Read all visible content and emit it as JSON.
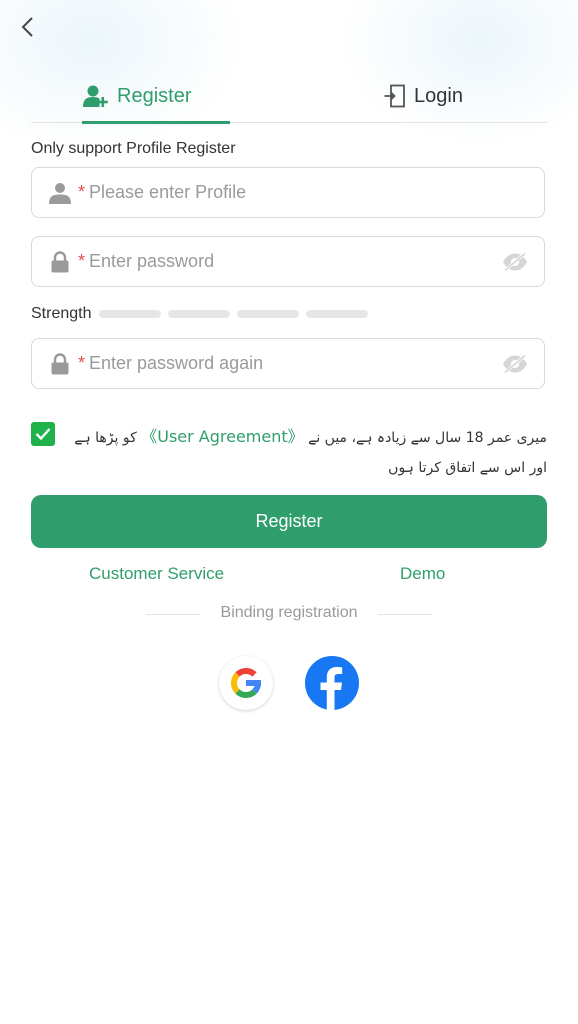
{
  "tabs": {
    "register_label": "Register",
    "login_label": "Login"
  },
  "form": {
    "hint": "Only support Profile Register",
    "profile": {
      "required_mark": "*",
      "placeholder": "Please enter Profile"
    },
    "password": {
      "required_mark": "*",
      "placeholder": "Enter password"
    },
    "strength_label": "Strength",
    "password_again": {
      "required_mark": "*",
      "placeholder": "Enter password again"
    }
  },
  "agreement": {
    "checked": true,
    "text_before": "میری عمر 18 سال سے زیادہ ہے، میں نے",
    "link": "《User Agreement》",
    "text_after": "کو پڑھا ہے اور اس سے اتفاق کرتا ہوں"
  },
  "actions": {
    "register_button": "Register",
    "customer_service": "Customer Service",
    "demo": "Demo"
  },
  "binding": {
    "label": "Binding registration"
  },
  "icons": {
    "back": "back-chevron-icon",
    "register_tab": "user-plus-icon",
    "login_tab": "login-door-icon",
    "profile": "user-icon",
    "lock": "lock-icon",
    "eye": "eye-off-icon",
    "google": "google-icon",
    "facebook": "facebook-icon"
  },
  "colors": {
    "accent": "#2f9e6c",
    "checkbox": "#1fb24a",
    "facebook": "#1877f2",
    "required": "#d9534f"
  }
}
